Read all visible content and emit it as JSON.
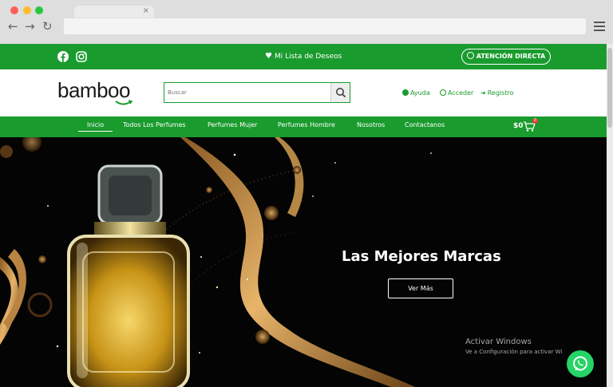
{
  "browser": {
    "tab_close": "×",
    "back": "←",
    "forward": "→",
    "reload": "↻"
  },
  "topbar": {
    "wishlist": "Mi Lista de Deseos",
    "attention_button": "ATENCIÓN DIRECTA",
    "social_icons": [
      "facebook-icon",
      "instagram-icon"
    ]
  },
  "header": {
    "logo": "bamboo",
    "search_placeholder": "Buscar",
    "links": {
      "help": "Ayuda",
      "login": "Acceder",
      "register": "Registro"
    }
  },
  "nav": {
    "items": [
      {
        "label": "Inicio",
        "active": true
      },
      {
        "label": "Todos Los Perfumes",
        "active": false
      },
      {
        "label": "Perfumes Mujer",
        "active": false
      },
      {
        "label": "Perfumes Hombre",
        "active": false
      },
      {
        "label": "Nosotros",
        "active": false
      },
      {
        "label": "Contactanos",
        "active": false
      }
    ],
    "cart_total": "$0",
    "cart_count": "0"
  },
  "hero": {
    "title": "Las Mejores Marcas",
    "button": "Ver Más"
  },
  "watermark": {
    "line1": "Activar Windows",
    "line2": "Ve a Configuración para activar Wi"
  },
  "colors": {
    "brand_green": "#1a9b2e",
    "hero_bg": "#040404",
    "whatsapp": "#25d366"
  }
}
